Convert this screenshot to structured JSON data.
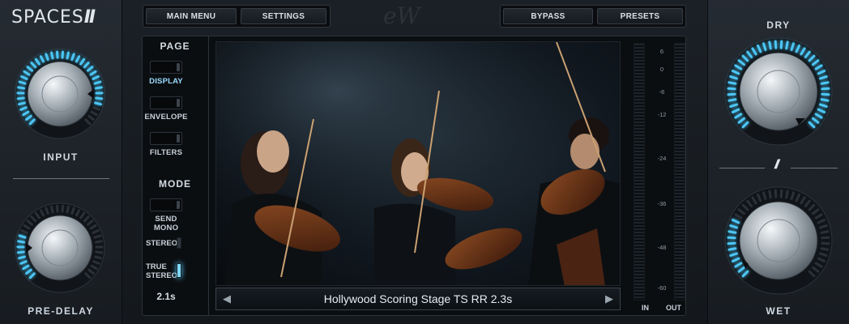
{
  "brand": {
    "product": "SPACES",
    "product_suffix": "II"
  },
  "toolbar": {
    "main_menu": "MAIN MENU",
    "settings": "SETTINGS",
    "bypass": "BYPASS",
    "presets": "PRESETS"
  },
  "knobs": {
    "input": {
      "label": "INPUT"
    },
    "pre_delay": {
      "label": "PRE-DELAY"
    },
    "dry": {
      "label": "DRY"
    },
    "wet": {
      "label": "WET"
    }
  },
  "page": {
    "heading": "PAGE",
    "items": [
      {
        "label": "DISPLAY",
        "active": true
      },
      {
        "label": "ENVELOPE",
        "active": false
      },
      {
        "label": "FILTERS",
        "active": false
      }
    ]
  },
  "mode": {
    "heading": "MODE",
    "send_mono": "SEND MONO",
    "stereo": "STEREO",
    "true_stereo_line1": "TRUE",
    "true_stereo_line2": "STEREO",
    "selected": "TRUE STEREO"
  },
  "time_readout": "2.1s",
  "preset_name": "Hollywood Scoring Stage TS RR 2.3s",
  "meter": {
    "scale": [
      "6",
      "0",
      "-6",
      "-12",
      "-24",
      "-36",
      "-48",
      "-60"
    ],
    "in_label": "IN",
    "out_label": "OUT"
  },
  "colors": {
    "accent": "#4cc6f5",
    "panel": "#1f242a",
    "background": "#0b0e11"
  }
}
